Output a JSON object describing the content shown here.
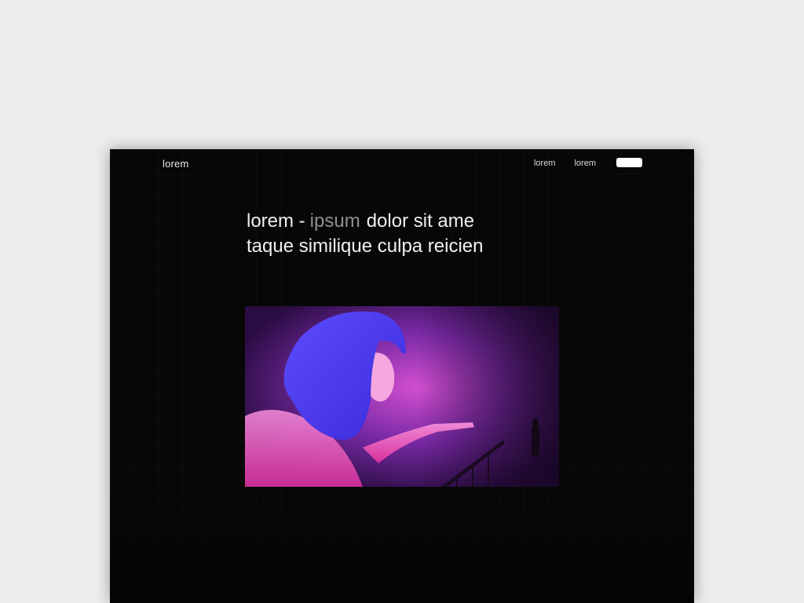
{
  "nav": {
    "brand": "lorem",
    "links": [
      "lorem",
      "lorem"
    ],
    "cta_label": ""
  },
  "hero": {
    "heading_part1": "lorem -",
    "heading_accent": "ipsum",
    "heading_part2": "dolor sit ame",
    "heading_line2": "taque similique culpa reicien",
    "image": "neon-portrait-image"
  },
  "colors": {
    "background": "#070707",
    "page_bg": "#ededed",
    "text": "#f0f0f0",
    "accent_text": "#8f8f8f",
    "button": "#ffffff"
  }
}
